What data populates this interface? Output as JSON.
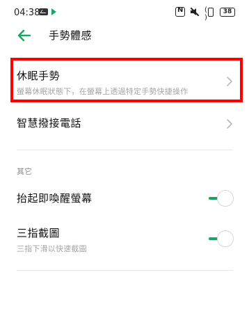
{
  "status_bar": {
    "time": "04:38",
    "battery": "38",
    "icons": [
      "mail-icon",
      "play-icon",
      "nfc-icon",
      "mute-icon",
      "vibrate-icon",
      "battery-icon"
    ]
  },
  "header": {
    "title": "手勢體感",
    "back_icon": "arrow-left-icon"
  },
  "items": [
    {
      "title": "休眠手勢",
      "subtitle": "螢幕休眠狀態下，在螢幕上透過特定手勢快捷操作",
      "control": "chevron"
    },
    {
      "title": "智慧撥接電話",
      "control": "chevron"
    }
  ],
  "section": {
    "label": "其它",
    "items": [
      {
        "title": "抬起即喚醒螢幕",
        "control": "toggle",
        "on": true
      },
      {
        "title": "三指截圖",
        "subtitle": "三指下滑以快速截圖",
        "control": "toggle",
        "on": true
      }
    ]
  },
  "colors": {
    "accent": "#1aa564",
    "highlight": "#ff0000",
    "subtext": "#a6a6a6"
  }
}
